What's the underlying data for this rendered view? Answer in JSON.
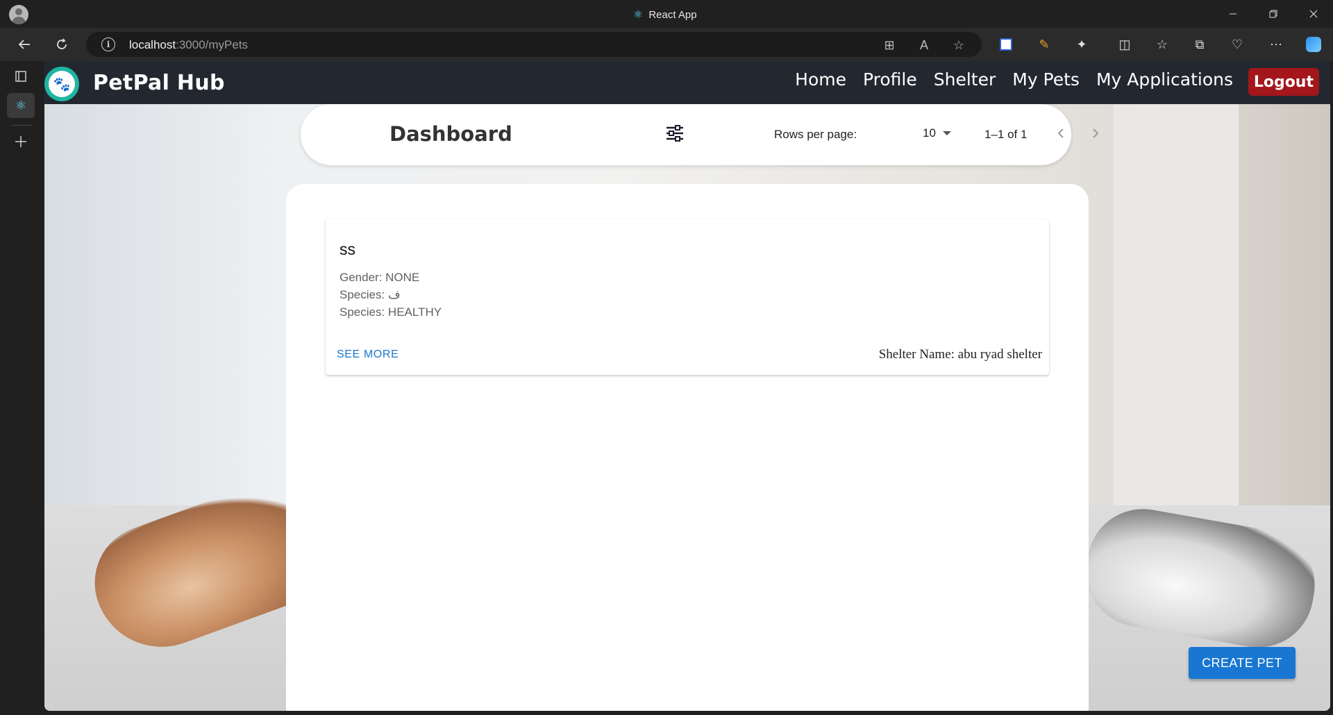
{
  "browser": {
    "tab_title": "React App",
    "url_host": "localhost",
    "url_path": ":3000/myPets"
  },
  "app": {
    "brand": "PetPal Hub",
    "menu": [
      "Home",
      "Profile",
      "Shelter",
      "My Pets",
      "My Applications"
    ],
    "logout_label": "Logout"
  },
  "dashboard": {
    "title": "Dashboard",
    "rows_per_page_label": "Rows per page:",
    "rows_per_page_value": "10",
    "range": "1–1 of 1"
  },
  "pets": [
    {
      "name": "ss",
      "gender": "Gender: NONE",
      "species": "Species: ف",
      "status": "Species: HEALTHY",
      "see_more": "SEE MORE",
      "shelter": "Shelter Name: abu ryad shelter"
    }
  ],
  "create_label": "CREATE PET",
  "colors": {
    "header": "#232830",
    "accent": "#1976d2",
    "logout": "#a3161c",
    "brand_teal": "#1fb5a3"
  }
}
